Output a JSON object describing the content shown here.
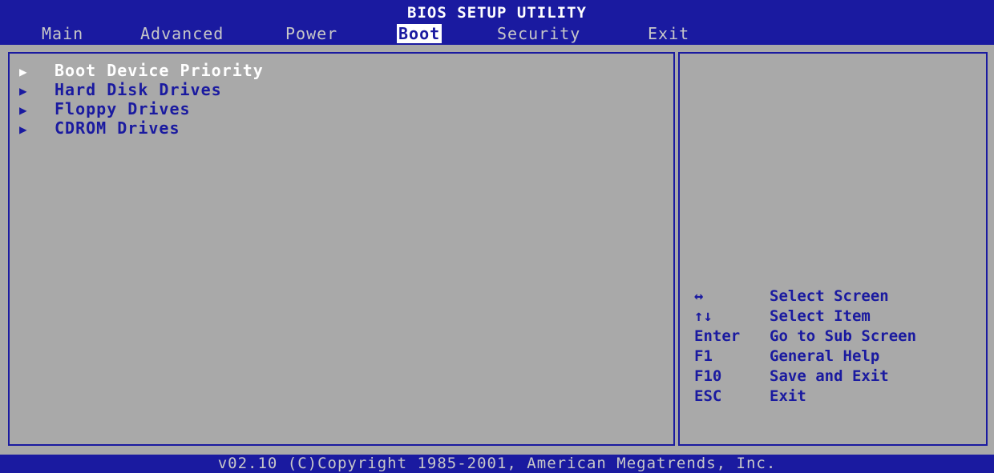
{
  "title": "BIOS SETUP UTILITY",
  "tabs": [
    {
      "label": "Main"
    },
    {
      "label": "Advanced"
    },
    {
      "label": "Power"
    },
    {
      "label": "Boot"
    },
    {
      "label": "Security"
    },
    {
      "label": "Exit"
    }
  ],
  "active_tab": "Boot",
  "boot_menu": {
    "items": [
      {
        "arrow": "▶",
        "label": "Boot Device Priority"
      },
      {
        "arrow": "▶",
        "label": "Hard Disk Drives"
      },
      {
        "arrow": "▶",
        "label": "Floppy Drives"
      },
      {
        "arrow": "▶",
        "label": "CDROM Drives"
      }
    ],
    "selected": "Boot Device Priority"
  },
  "help": {
    "rows": [
      {
        "key": "↔",
        "desc": "Select Screen"
      },
      {
        "key": "↑↓",
        "desc": "Select Item"
      },
      {
        "key": "Enter",
        "desc": "Go to Sub Screen"
      },
      {
        "key": "F1",
        "desc": "General Help"
      },
      {
        "key": "F10",
        "desc": "Save and Exit"
      },
      {
        "key": "ESC",
        "desc": "Exit"
      }
    ]
  },
  "footer": "v02.10 (C)Copyright 1985-2001, American Megatrends, Inc.",
  "colors": {
    "background": "#a9a9a9",
    "bar": "#1a1aa0",
    "highlight": "#ffffff"
  }
}
